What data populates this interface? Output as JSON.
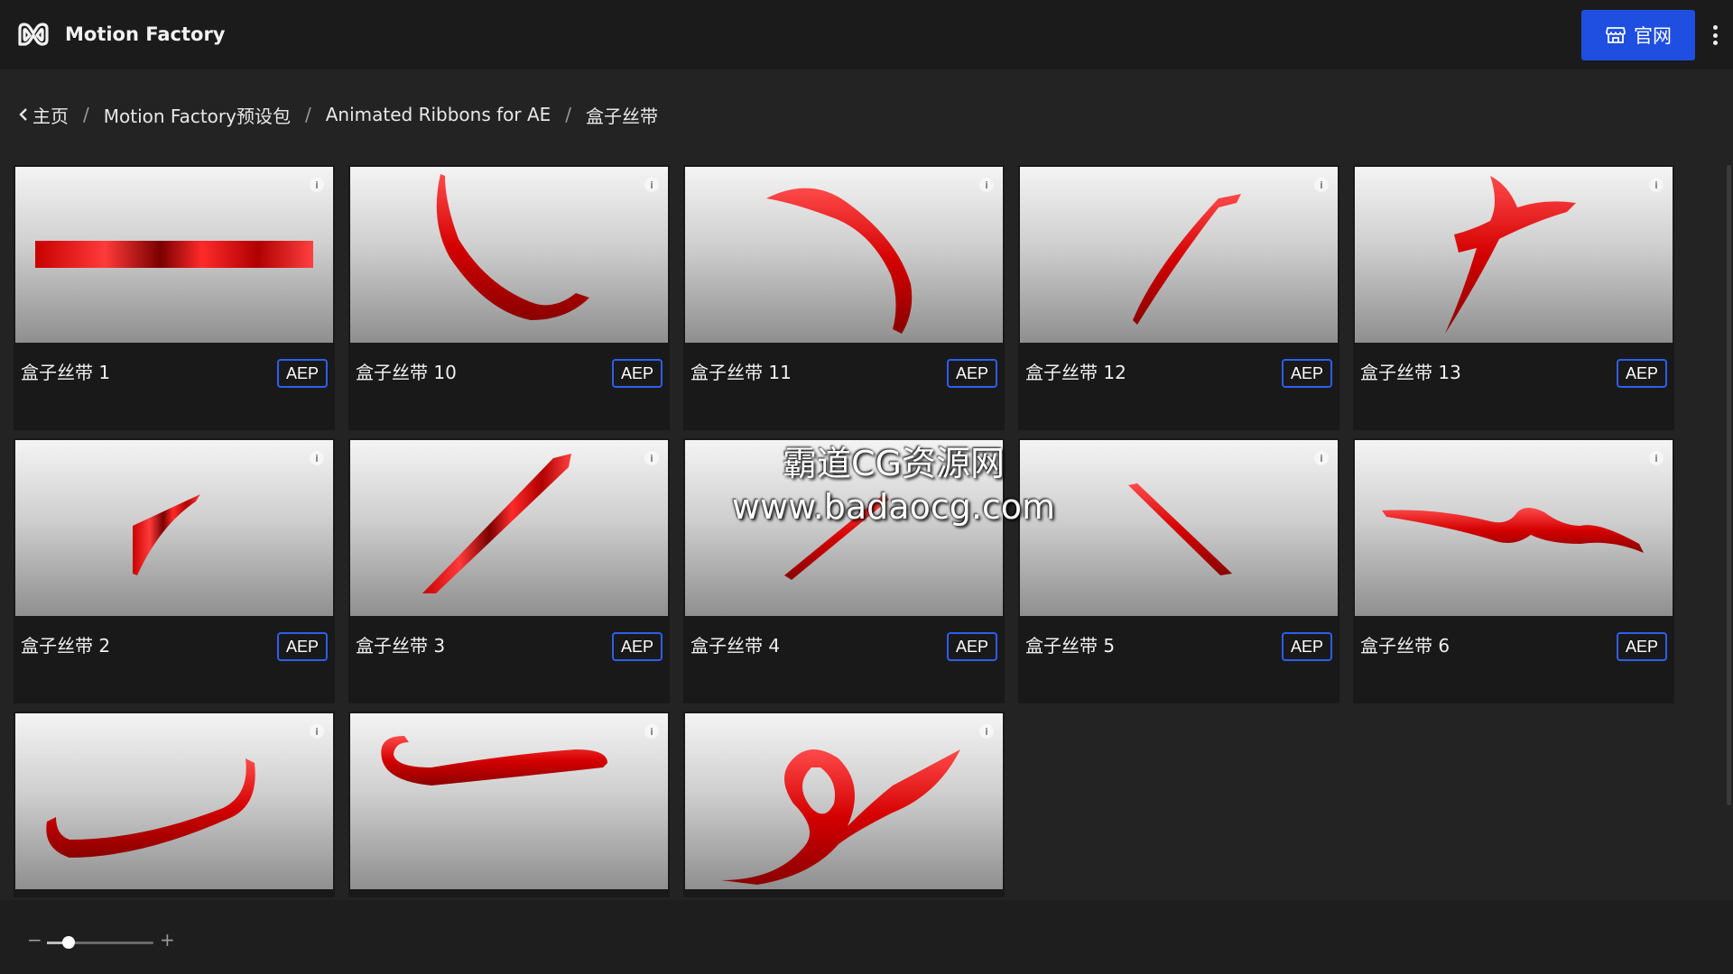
{
  "header": {
    "app_title": "Motion Factory",
    "logo_icon": "mf-logo-icon",
    "official_site_label": "官网",
    "official_site_icon": "store-icon",
    "more_icon": "more-vertical-icon",
    "accent_color": "#1f4fe0"
  },
  "breadcrumb": {
    "items": [
      "主页",
      "Motion Factory预设包",
      "Animated Ribbons for AE",
      "盒子丝带"
    ],
    "separator": "/"
  },
  "grid": {
    "badge_color": "#2c5ef0",
    "items": [
      {
        "title": "盒子丝带 1",
        "badge": "AEP"
      },
      {
        "title": "盒子丝带 10",
        "badge": "AEP"
      },
      {
        "title": "盒子丝带 11",
        "badge": "AEP"
      },
      {
        "title": "盒子丝带 12",
        "badge": "AEP"
      },
      {
        "title": "盒子丝带 13",
        "badge": "AEP"
      },
      {
        "title": "盒子丝带 2",
        "badge": "AEP"
      },
      {
        "title": "盒子丝带 3",
        "badge": "AEP"
      },
      {
        "title": "盒子丝带 4",
        "badge": "AEP"
      },
      {
        "title": "盒子丝带 5",
        "badge": "AEP"
      },
      {
        "title": "盒子丝带 6",
        "badge": "AEP"
      },
      {
        "title": "",
        "badge": ""
      },
      {
        "title": "",
        "badge": ""
      },
      {
        "title": "",
        "badge": ""
      }
    ]
  },
  "watermark": {
    "line1": "霸道CG资源网",
    "line2": "www.badaocg.com"
  },
  "zoom": {
    "minus_label": "−",
    "plus_label": "+",
    "level": 0.2
  }
}
